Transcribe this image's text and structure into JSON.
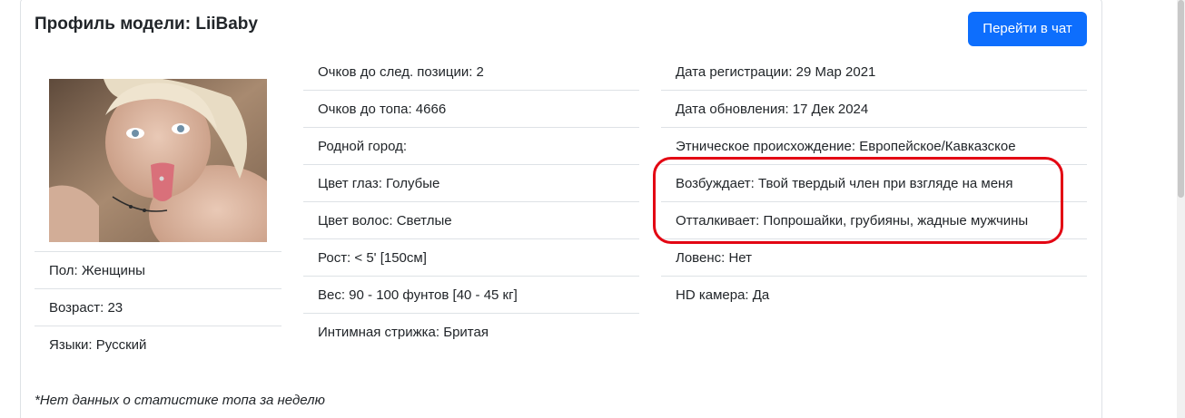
{
  "profile": {
    "title": "Профиль модели: LiiBaby",
    "chat_button": "Перейти в чат",
    "photo_label": "model-photo"
  },
  "left_list": [
    "Пол: Женщины",
    "Возраст: 23",
    "Языки: Русский"
  ],
  "middle_list": [
    "Очков до след. позиции: 2",
    "Очков до топа: 4666",
    "Родной город:",
    "Цвет глаз: Голубые",
    "Цвет волос: Светлые",
    "Рост: < 5' [150см]",
    "Вес: 90 - 100 фунтов [40 - 45 кг]",
    "Интимная стрижка: Бритая"
  ],
  "right_list": [
    "Дата регистрации: 29 Мар 2021",
    "Дата обновления: 17 Дек 2024",
    "Этническое происхождение: Европейское/Кавказское",
    "Возбуждает: Твой твердый член при взгляде на меня",
    "Отталкивает: Попрошайки, грубияны, жадные мужчины",
    "Ловенс: Нет",
    "HD камера: Да"
  ],
  "footnote": "*Нет данных о статистике топа за неделю",
  "colors": {
    "primary": "#0d6efd",
    "highlight": "#e30613",
    "border": "#dee2e6"
  }
}
